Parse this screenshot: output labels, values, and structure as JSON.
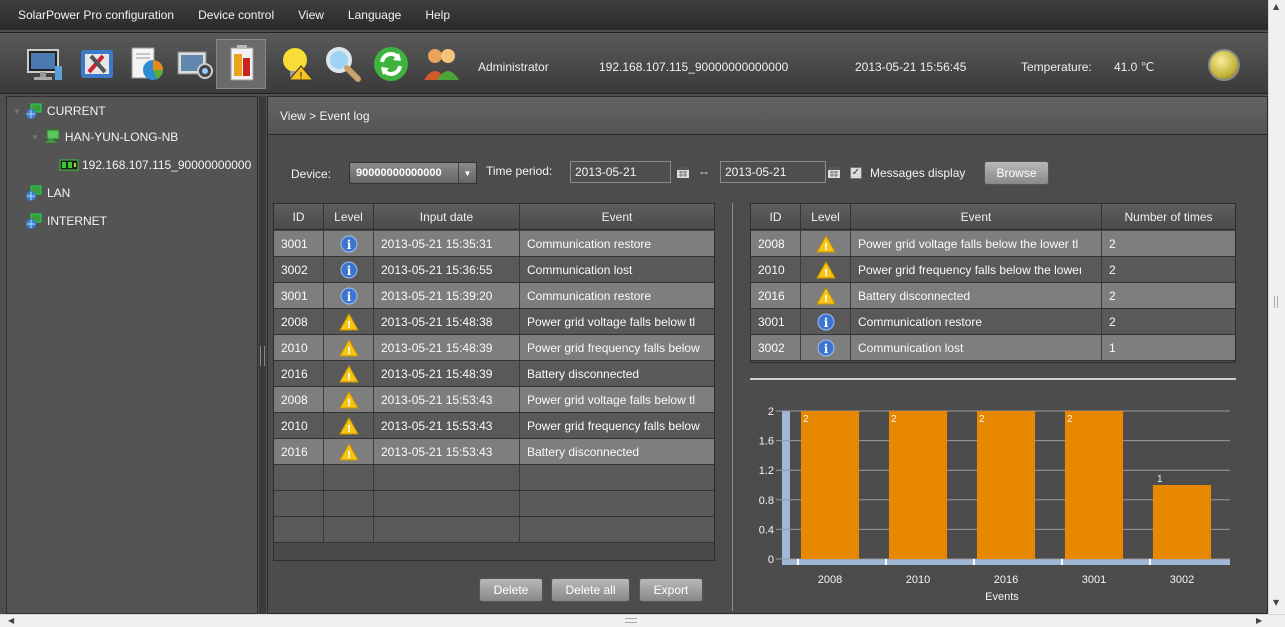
{
  "menu": [
    "SolarPower Pro configuration",
    "Device control",
    "View",
    "Language",
    "Help"
  ],
  "toolbar": {
    "icons": [
      "monitor-icon",
      "tools-icon",
      "report-chart-icon",
      "camera-icon",
      "battery-icon",
      "warning-bulb-icon",
      "search-icon",
      "refresh-icon",
      "users-icon"
    ],
    "user": "Administrator",
    "device_id": "192.168.107.115_90000000000000",
    "datetime": "2013-05-21 15:56:45",
    "temperature_label": "Temperature:",
    "temperature_value": "41.0 ℃",
    "status_indicator_color": "#d4c24a"
  },
  "sidebar": {
    "items": [
      {
        "label": "CURRENT",
        "icon": "network-icon"
      },
      {
        "label": "HAN-YUN-LONG-NB",
        "icon": "computer-icon"
      },
      {
        "label": "192.168.107.115_90000000000",
        "icon": "device-icon"
      },
      {
        "label": "LAN",
        "icon": "network-icon"
      },
      {
        "label": "INTERNET",
        "icon": "network-icon"
      }
    ]
  },
  "main": {
    "breadcrumb": "View > Event log",
    "device_label": "Device:",
    "device_value": "90000000000000",
    "time_period_label": "Time period:",
    "date_from": "2013-05-21",
    "date_sep": "--",
    "date_to": "2013-05-21",
    "messages_display_label": "Messages display",
    "messages_display_checked": true,
    "browse_label": "Browse"
  },
  "event_table": {
    "columns": [
      "ID",
      "Level",
      "Input date",
      "Event"
    ],
    "rows": [
      {
        "id": "3001",
        "level": "info",
        "date": "2013-05-21 15:35:31",
        "event": "Communication restore"
      },
      {
        "id": "3002",
        "level": "info",
        "date": "2013-05-21 15:36:55",
        "event": "Communication lost"
      },
      {
        "id": "3001",
        "level": "info",
        "date": "2013-05-21 15:39:20",
        "event": "Communication restore"
      },
      {
        "id": "2008",
        "level": "warning",
        "date": "2013-05-21 15:48:38",
        "event": "Power grid voltage falls below tl"
      },
      {
        "id": "2010",
        "level": "warning",
        "date": "2013-05-21 15:48:39",
        "event": "Power grid frequency falls below"
      },
      {
        "id": "2016",
        "level": "warning",
        "date": "2013-05-21 15:48:39",
        "event": "Battery disconnected"
      },
      {
        "id": "2008",
        "level": "warning",
        "date": "2013-05-21 15:53:43",
        "event": "Power grid voltage falls below tl"
      },
      {
        "id": "2010",
        "level": "warning",
        "date": "2013-05-21 15:53:43",
        "event": "Power grid frequency falls below"
      },
      {
        "id": "2016",
        "level": "warning",
        "date": "2013-05-21 15:53:43",
        "event": "Battery disconnected"
      }
    ],
    "buttons": {
      "delete": "Delete",
      "delete_all": "Delete all",
      "export": "Export"
    }
  },
  "summary_table": {
    "columns": [
      "ID",
      "Level",
      "Event",
      "Number of times"
    ],
    "rows": [
      {
        "id": "2008",
        "level": "warning",
        "event": "Power grid voltage falls below the lower tl",
        "count": "2"
      },
      {
        "id": "2010",
        "level": "warning",
        "event": "Power grid frequency falls below the loweı",
        "count": "2"
      },
      {
        "id": "2016",
        "level": "warning",
        "event": "Battery disconnected",
        "count": "2"
      },
      {
        "id": "3001",
        "level": "info",
        "event": "Communication restore",
        "count": "2"
      },
      {
        "id": "3002",
        "level": "info",
        "event": "Communication lost",
        "count": "1"
      }
    ]
  },
  "chart_data": {
    "type": "bar",
    "categories": [
      "2008",
      "2010",
      "2016",
      "3001",
      "3002"
    ],
    "values": [
      2,
      2,
      2,
      2,
      1
    ],
    "xlabel": "Events",
    "ylabel": "",
    "ylim": [
      0,
      2
    ],
    "yticks": [
      "0",
      "0.4",
      "0.8",
      "1.2",
      "1.6",
      "2"
    ],
    "data_labels": [
      "2",
      "2",
      "2",
      "2",
      "1"
    ],
    "bar_color": "#e88800",
    "grid": true
  }
}
